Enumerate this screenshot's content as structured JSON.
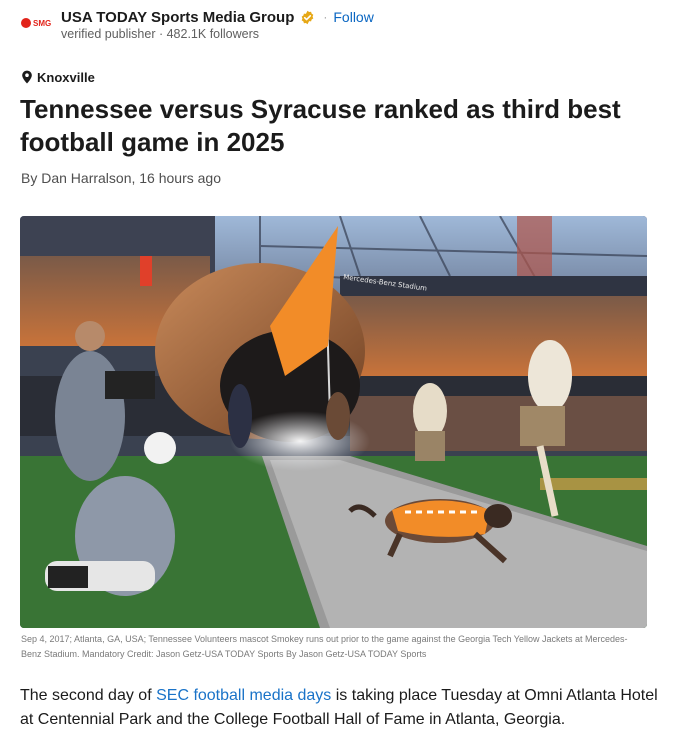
{
  "publisher": {
    "logo_text": "SMG",
    "name": "USA TODAY Sports Media Group",
    "separator": "·",
    "follow_label": "Follow",
    "meta": "verified publisher · 482.1K followers"
  },
  "article": {
    "location": "Knoxville",
    "title": "Tennessee versus Syracuse ranked as third best football game in 2025",
    "byline": "By Dan Harralson, 16 hours ago",
    "image": {
      "sign_text": "Mercedes-Benz Stadium",
      "caption": "Sep 4, 2017; Atlanta, GA, USA; Tennessee Volunteers mascot Smokey runs out prior to the game against the Georgia Tech Yellow Jackets at Mercedes-Benz Stadium. Mandatory Credit: Jason Getz-USA TODAY Sports By Jason Getz-USA TODAY Sports"
    },
    "lead": {
      "before": "The second day of ",
      "link": "SEC football media days",
      "after": " is taking place Tuesday at Omni Atlanta Hotel at Centennial Park and the College Football Hall of Fame in Atlanta, Georgia."
    }
  },
  "colors": {
    "link": "#1a73c8",
    "follow": "#0a66c2",
    "tennessee_orange": "#f28c28",
    "verified_badge": "#e6a817"
  }
}
